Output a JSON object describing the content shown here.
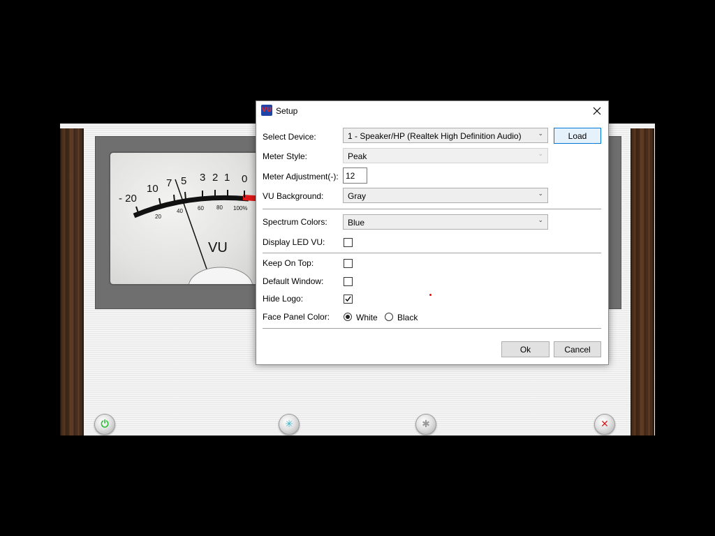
{
  "background_app": {
    "meter": {
      "scale_labels": [
        "- 20",
        "10",
        "7",
        "5",
        "3",
        "2",
        "1",
        "0"
      ],
      "percent_labels": [
        "20",
        "40",
        "60",
        "80",
        "100%"
      ],
      "label": "VU"
    },
    "controls": [
      {
        "name": "power",
        "icon": "power-icon",
        "color": "#2fbf3a"
      },
      {
        "name": "spectrum",
        "icon": "spectrum-icon",
        "color": "#3bb3c9"
      },
      {
        "name": "settings",
        "icon": "settings-icon",
        "color": "#9a9a9a"
      },
      {
        "name": "close",
        "icon": "close-icon",
        "color": "#d41c1c"
      }
    ]
  },
  "dialog": {
    "title": "Setup",
    "logo_text": "VU",
    "fields": {
      "select_device": {
        "label": "Select Device:",
        "value": "1 - Speaker/HP (Realtek High Definition Audio)"
      },
      "meter_style": {
        "label": "Meter Style:",
        "value": "Peak",
        "disabled": true
      },
      "meter_adjustment": {
        "label": "Meter Adjustment(-):",
        "value": "12"
      },
      "vu_background": {
        "label": "VU Background:",
        "value": "Gray"
      },
      "spectrum_colors": {
        "label": "Spectrum Colors:",
        "value": "Blue"
      },
      "display_led_vu": {
        "label": "Display LED VU:",
        "checked": false
      },
      "keep_on_top": {
        "label": "Keep On Top:",
        "checked": false
      },
      "default_window": {
        "label": "Default Window:",
        "checked": false
      },
      "hide_logo": {
        "label": "Hide Logo:",
        "checked": true
      },
      "face_panel_color": {
        "label": "Face Panel Color:",
        "options": [
          "White",
          "Black"
        ],
        "selected": "White"
      }
    },
    "buttons": {
      "load": "Load",
      "ok": "Ok",
      "cancel": "Cancel"
    }
  }
}
